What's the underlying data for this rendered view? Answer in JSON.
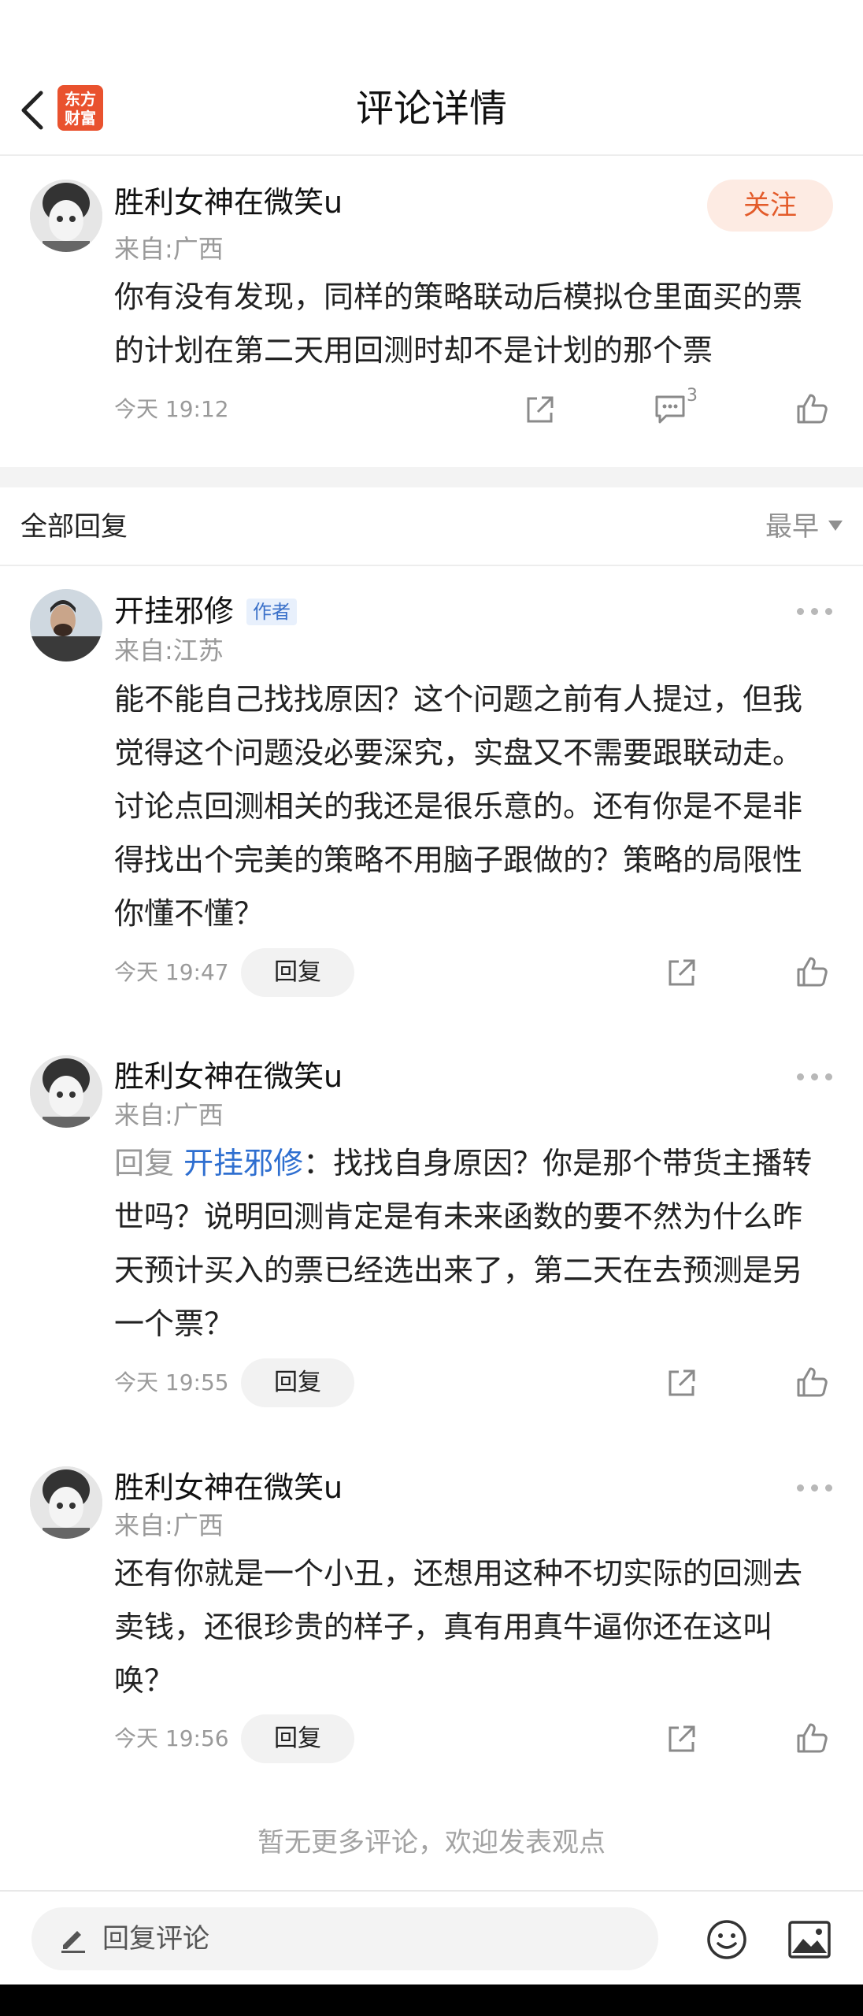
{
  "header": {
    "title": "评论详情",
    "logo_text_line1": "东方",
    "logo_text_line2": "财富"
  },
  "main_comment": {
    "username": "胜利女神在微笑u",
    "region": "来自:广西",
    "follow_label": "关注",
    "text_line1": "你有没有发现，同样的策略联动后模拟仓里面买的票",
    "text_line2": "的计划在第二天用回测时却不是计划的那个票",
    "time": "今天 19:12",
    "reply_count": "3"
  },
  "replies_section": {
    "title": "全部回复",
    "sort_label": "最早"
  },
  "replies": [
    {
      "username": "开挂邪修",
      "badge": "作者",
      "region": "来自:江苏",
      "lines": [
        "能不能自己找找原因？这个问题之前有人提过，但我",
        "觉得这个问题没必要深究，实盘又不需要跟联动走。",
        "讨论点回测相关的我还是很乐意的。还有你是不是非",
        "得找出个完美的策略不用脑子跟做的？策略的局限性",
        "你懂不懂？"
      ],
      "time": "今天 19:47",
      "reply_label": "回复"
    },
    {
      "username": "胜利女神在微笑u",
      "region": "来自:广西",
      "reply_prefix": "回复 ",
      "reply_target": "开挂邪修",
      "line1_rest": "：找找自身原因？你是那个带货主播转",
      "lines": [
        "世吗？说明回测肯定是有未来函数的要不然为什么昨",
        "天预计买入的票已经选出来了，第二天在去预测是另",
        "一个票？"
      ],
      "time": "今天 19:55",
      "reply_label": "回复"
    },
    {
      "username": "胜利女神在微笑u",
      "region": "来自:广西",
      "lines": [
        "还有你就是一个小丑，还想用这种不切实际的回测去",
        "卖钱，还很珍贵的样子，真有用真牛逼你还在这叫",
        "唤？"
      ],
      "time": "今天 19:56",
      "reply_label": "回复"
    }
  ],
  "footer_note": "暂无更多评论，欢迎发表观点",
  "bottom_bar": {
    "input_placeholder": "回复评论"
  },
  "colors": {
    "accent_orange": "#e35b2a",
    "link_blue": "#2f6fd0",
    "muted_gray": "#9a9a9a"
  }
}
